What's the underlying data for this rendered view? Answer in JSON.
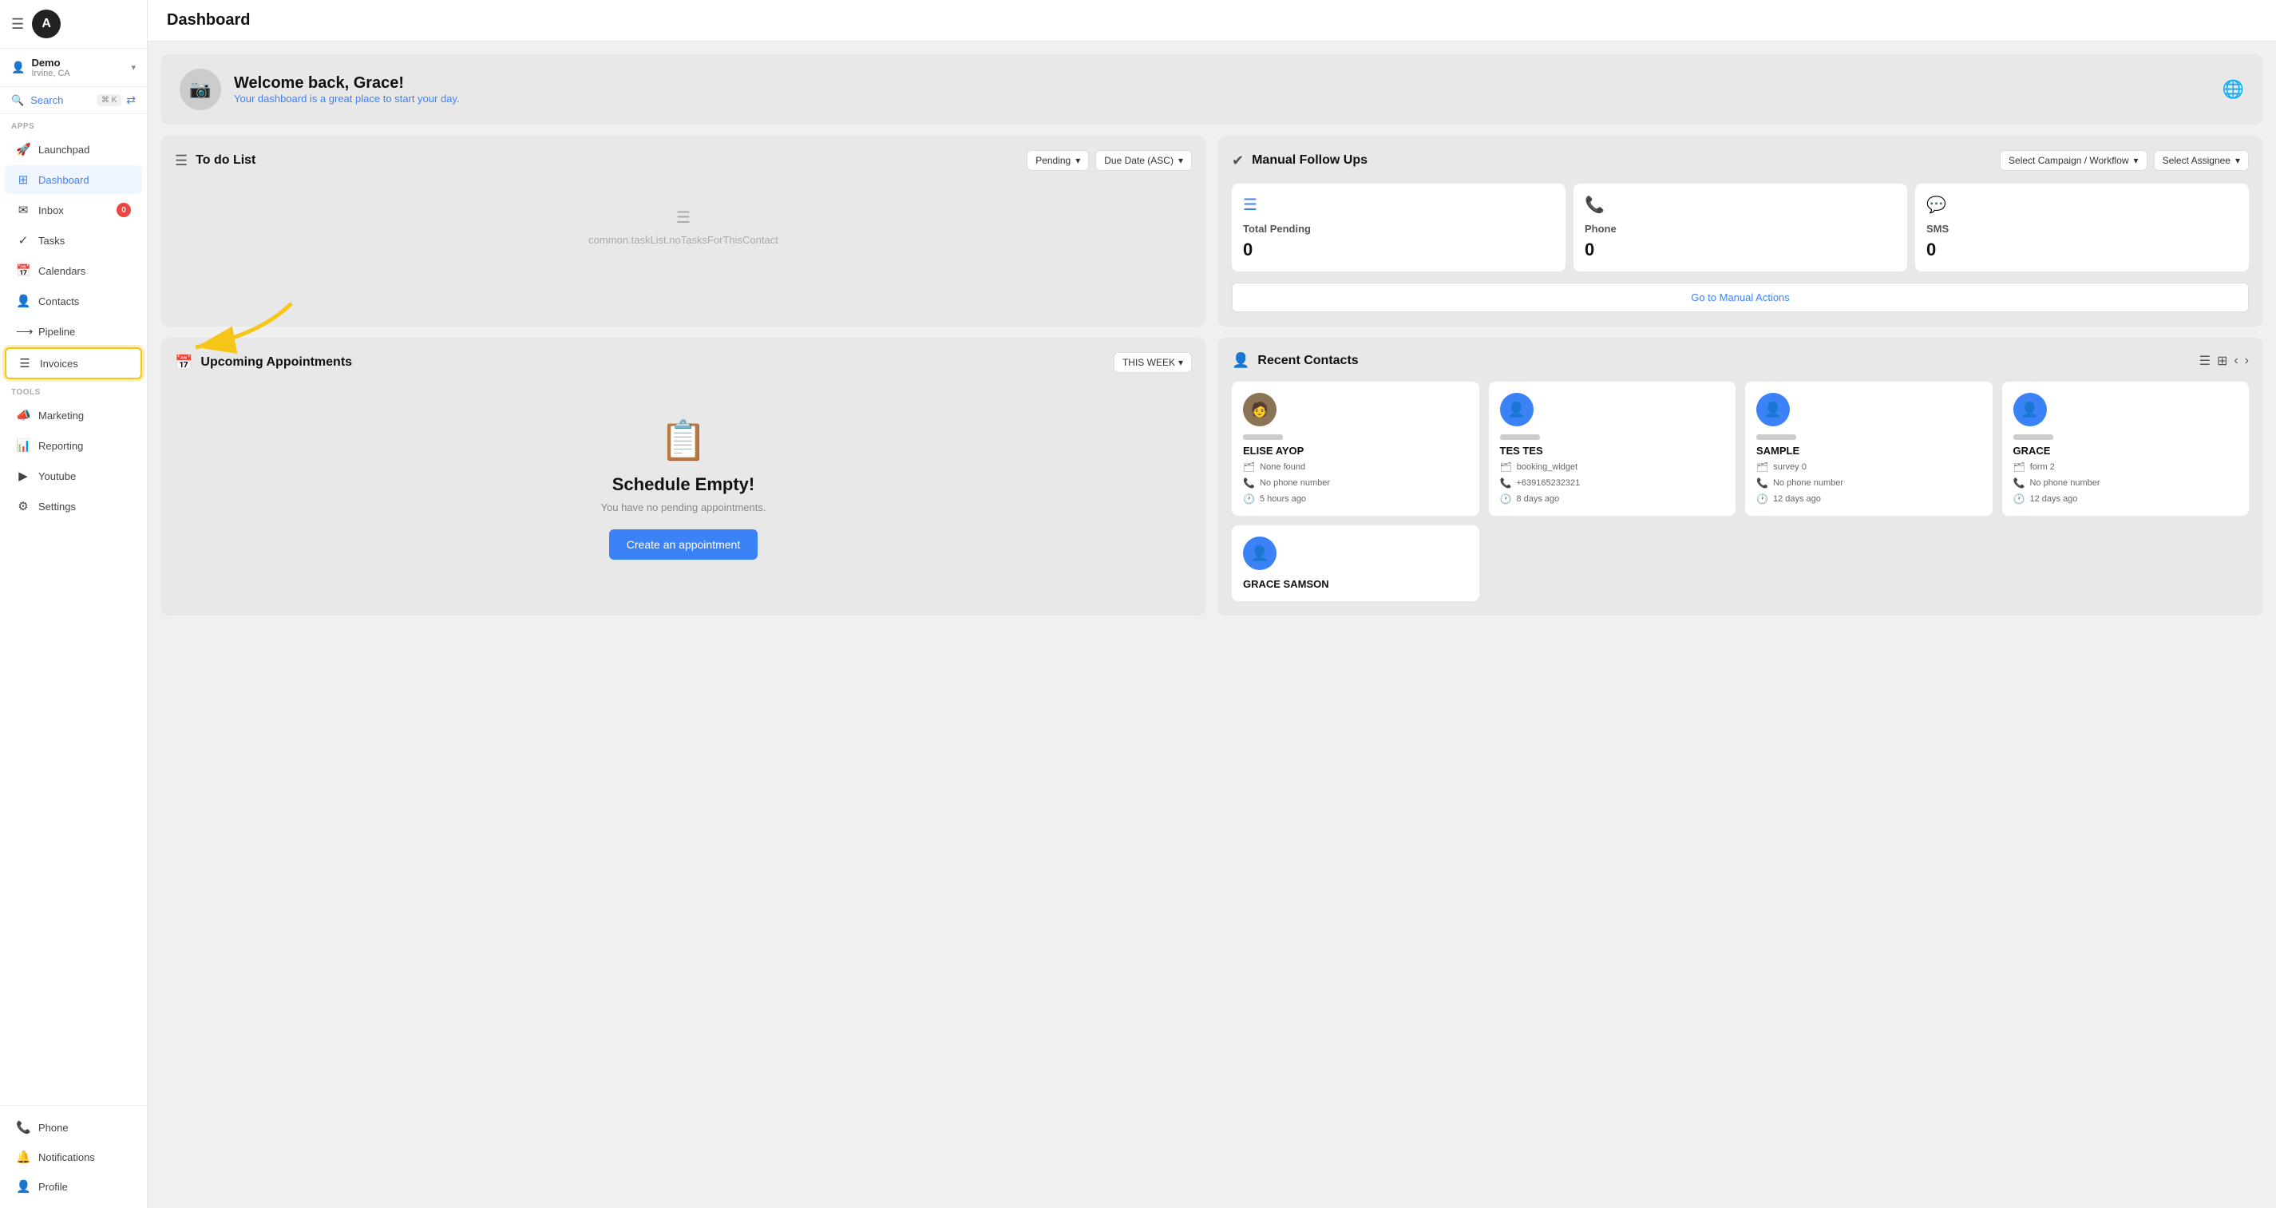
{
  "app": {
    "logo_letter": "A",
    "title": "Dashboard"
  },
  "sidebar": {
    "account_name": "Demo",
    "account_location": "Irvine, CA",
    "search_label": "Search",
    "search_shortcut": "⌘ K",
    "apps_label": "Apps",
    "tools_label": "Tools",
    "nav_items": [
      {
        "id": "launchpad",
        "label": "Launchpad",
        "icon": "🚀",
        "active": false
      },
      {
        "id": "dashboard",
        "label": "Dashboard",
        "icon": "⊞",
        "active": true
      },
      {
        "id": "inbox",
        "label": "Inbox",
        "icon": "📥",
        "active": false,
        "badge": "0"
      },
      {
        "id": "tasks",
        "label": "Tasks",
        "icon": "✓",
        "active": false
      },
      {
        "id": "calendars",
        "label": "Calendars",
        "icon": "📅",
        "active": false
      },
      {
        "id": "contacts",
        "label": "Contacts",
        "icon": "👤",
        "active": false
      },
      {
        "id": "pipeline",
        "label": "Pipeline",
        "icon": "⟶",
        "active": false
      },
      {
        "id": "invoices",
        "label": "Invoices",
        "icon": "☰",
        "active": false,
        "highlighted": true
      }
    ],
    "tool_items": [
      {
        "id": "marketing",
        "label": "Marketing",
        "icon": "📣",
        "active": false
      },
      {
        "id": "reporting",
        "label": "Reporting",
        "icon": "📊",
        "active": false
      },
      {
        "id": "youtube",
        "label": "Youtube",
        "icon": "▶",
        "active": false
      },
      {
        "id": "settings",
        "label": "Settings",
        "icon": "⚙",
        "active": false
      }
    ],
    "bottom_items": [
      {
        "id": "phone",
        "label": "Phone",
        "icon": "📞"
      },
      {
        "id": "notifications",
        "label": "Notifications",
        "icon": "🔔"
      },
      {
        "id": "profile",
        "label": "Profile",
        "icon": "👤"
      }
    ]
  },
  "welcome": {
    "title": "Welcome back, Grace!",
    "subtitle": "Your dashboard is a great place to start your day.",
    "avatar_icon": "📷"
  },
  "todo": {
    "title": "To do List",
    "filter_pending": "Pending",
    "filter_due": "Due Date (ASC)",
    "empty_text": "common.taskList.noTasksForThisContact"
  },
  "manual_follow_ups": {
    "title": "Manual Follow Ups",
    "filter_campaign": "Select Campaign / Workflow",
    "filter_assignee": "Select Assignee",
    "stats": [
      {
        "label": "Total Pending",
        "value": "0",
        "icon": "☰"
      },
      {
        "label": "Phone",
        "value": "0",
        "icon": "📞"
      },
      {
        "label": "SMS",
        "value": "0",
        "icon": "💬"
      }
    ],
    "action_btn": "Go to Manual Actions"
  },
  "appointments": {
    "title": "Upcoming Appointments",
    "filter_week": "THIS WEEK",
    "empty_title": "Schedule Empty!",
    "empty_sub": "You have no pending appointments.",
    "create_btn": "Create an appointment"
  },
  "recent_contacts": {
    "title": "Recent Contacts",
    "contacts": [
      {
        "name": "ELISE AYOP",
        "source": "None found",
        "phone": "No phone number",
        "time": "5 hours ago",
        "has_photo": true
      },
      {
        "name": "TES TES",
        "source": "booking_widget",
        "phone": "+639165232321",
        "time": "8 days ago",
        "has_photo": false
      },
      {
        "name": "SAMPLE",
        "source": "survey 0",
        "phone": "No phone number",
        "time": "12 days ago",
        "has_photo": false
      },
      {
        "name": "GRACE",
        "source": "form 2",
        "phone": "No phone number",
        "time": "12 days ago",
        "has_photo": false
      }
    ],
    "contacts_row2": [
      {
        "name": "GRACE SAMSON",
        "source": "",
        "phone": "",
        "time": "",
        "has_photo": false
      }
    ]
  }
}
